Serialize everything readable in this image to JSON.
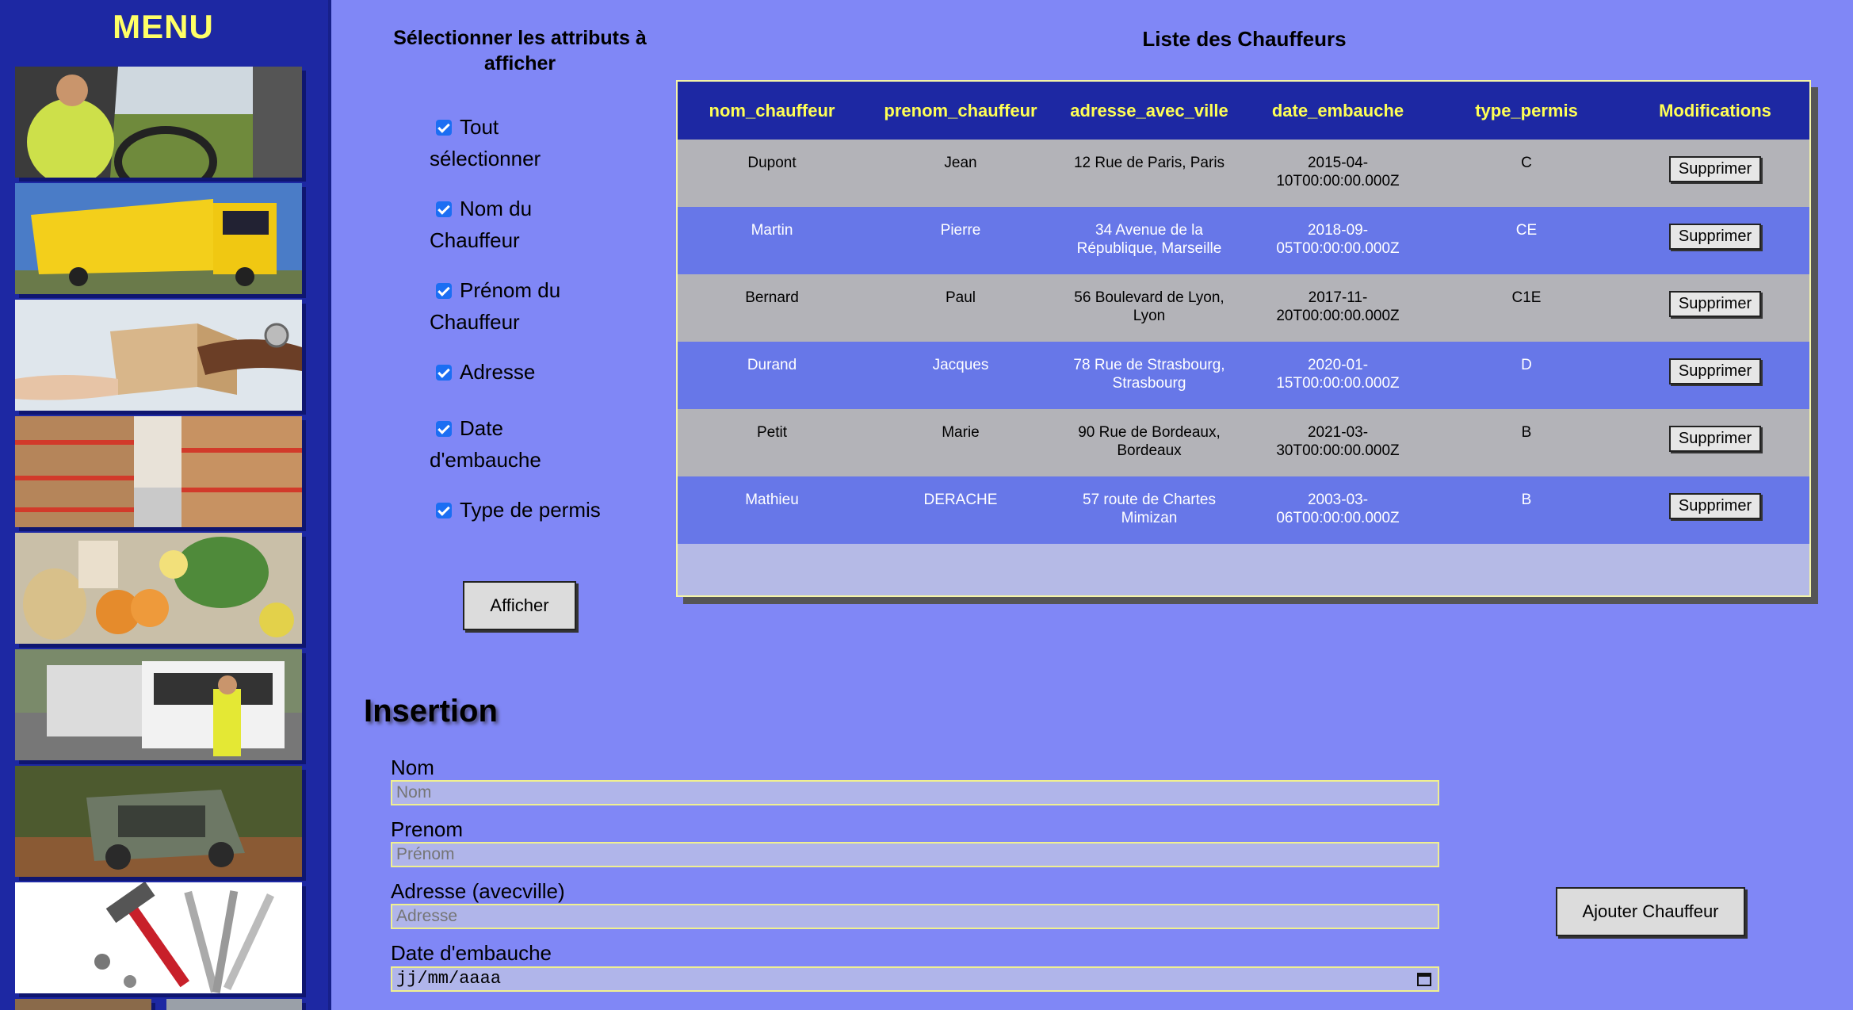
{
  "sidebar": {
    "title": "MENU",
    "images": [
      "truck-driver",
      "yellow-truck",
      "parcel-delivery",
      "warehouse-shelves",
      "produce-crates",
      "police-truck-check",
      "abandoned-truck",
      "tools"
    ]
  },
  "attributes": {
    "title": "Sélectionner les attributs à afficher",
    "items": [
      {
        "label": "Tout sélectionner",
        "checked": true
      },
      {
        "label": "Nom du Chauffeur",
        "checked": true
      },
      {
        "label": "Prénom du Chauffeur",
        "checked": true
      },
      {
        "label": "Adresse",
        "checked": true
      },
      {
        "label": "Date d'embauche",
        "checked": true
      },
      {
        "label": "Type de permis",
        "checked": true
      }
    ],
    "button": "Afficher"
  },
  "table": {
    "title": "Liste des Chauffeurs",
    "headers": [
      "nom_chauffeur",
      "prenom_chauffeur",
      "adresse_avec_ville",
      "date_embauche",
      "type_permis",
      "Modifications"
    ],
    "delete_label": "Supprimer",
    "rows": [
      {
        "nom": "Dupont",
        "prenom": "Jean",
        "adresse": "12 Rue de Paris, Paris",
        "date": "2015-04-10T00:00:00.000Z",
        "permis": "C"
      },
      {
        "nom": "Martin",
        "prenom": "Pierre",
        "adresse": "34 Avenue de la République, Marseille",
        "date": "2018-09-05T00:00:00.000Z",
        "permis": "CE"
      },
      {
        "nom": "Bernard",
        "prenom": "Paul",
        "adresse": "56 Boulevard de Lyon, Lyon",
        "date": "2017-11-20T00:00:00.000Z",
        "permis": "C1E"
      },
      {
        "nom": "Durand",
        "prenom": "Jacques",
        "adresse": "78 Rue de Strasbourg, Strasbourg",
        "date": "2020-01-15T00:00:00.000Z",
        "permis": "D"
      },
      {
        "nom": "Petit",
        "prenom": "Marie",
        "adresse": "90 Rue de Bordeaux, Bordeaux",
        "date": "2021-03-30T00:00:00.000Z",
        "permis": "B"
      },
      {
        "nom": "Mathieu",
        "prenom": "DERACHE",
        "adresse": "57 route de Chartes Mimizan",
        "date": "2003-03-06T00:00:00.000Z",
        "permis": "B"
      }
    ]
  },
  "insertion": {
    "title": "Insertion",
    "fields": {
      "nom": {
        "label": "Nom",
        "placeholder": "Nom"
      },
      "prenom": {
        "label": "Prenom",
        "placeholder": "Prénom"
      },
      "adresse": {
        "label": "Adresse (avecville)",
        "placeholder": "Adresse"
      },
      "date": {
        "label": "Date d'embauche",
        "value": "jj/mm/aaaa"
      }
    },
    "submit": "Ajouter Chauffeur"
  },
  "colors": {
    "background": "#8087f6",
    "sidebar": "#1d28a3",
    "header_text": "#ffff55",
    "row_light": "#b3b3b8",
    "row_dark": "#6777e8"
  }
}
